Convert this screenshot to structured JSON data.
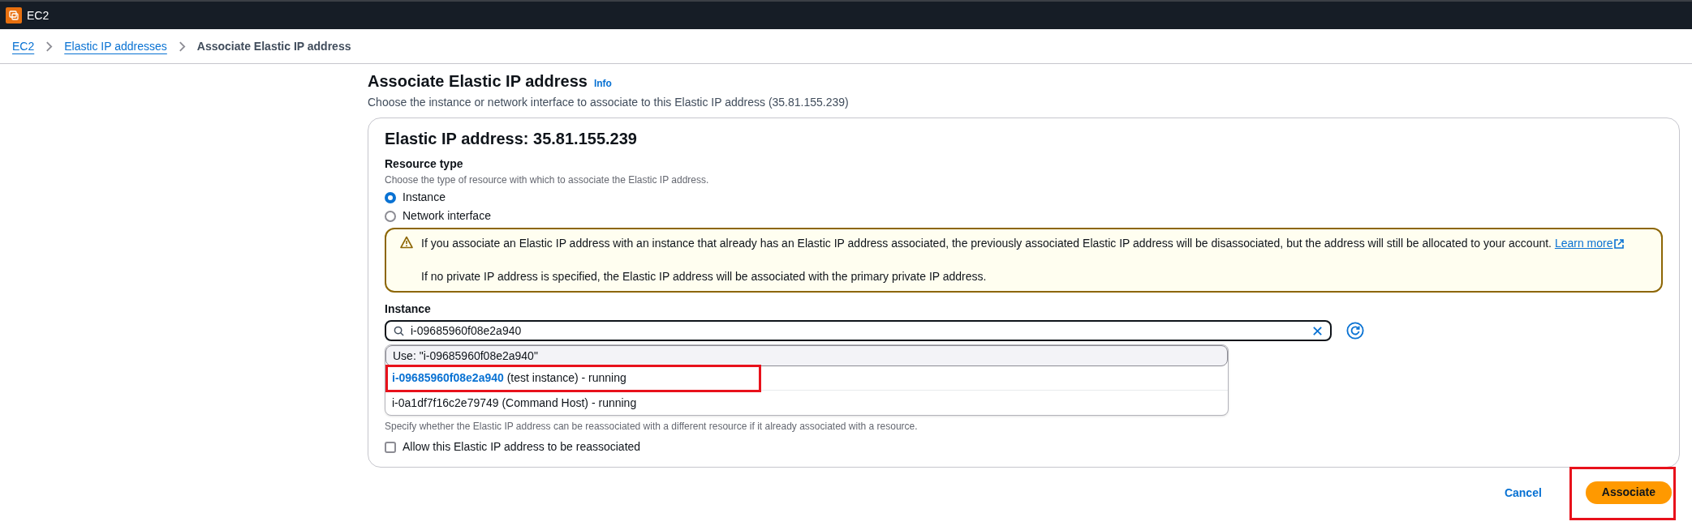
{
  "top_bar": {
    "service": "EC2"
  },
  "breadcrumbs": [
    {
      "label": "EC2",
      "link": true
    },
    {
      "label": "Elastic IP addresses",
      "link": true
    },
    {
      "label": "Associate Elastic IP address",
      "link": false
    }
  ],
  "page": {
    "title": "Associate Elastic IP address",
    "info": "Info",
    "description": "Choose the instance or network interface to associate to this Elastic IP address (35.81.155.239)"
  },
  "card": {
    "title": "Elastic IP address: 35.81.155.239",
    "resource_type": {
      "label": "Resource type",
      "hint": "Choose the type of resource with which to associate the Elastic IP address.",
      "options": [
        {
          "label": "Instance",
          "selected": true
        },
        {
          "label": "Network interface",
          "selected": false
        }
      ]
    },
    "warning": {
      "text": "If you associate an Elastic IP address with an instance that already has an Elastic IP address associated, the previously associated Elastic IP address will be disassociated, but the address will still be allocated to your account.",
      "link": "Learn more",
      "note": "If no private IP address is specified, the Elastic IP address will be associated with the primary private IP address."
    },
    "instance": {
      "label": "Instance",
      "value": "i-09685960f08e2a940",
      "dropdown": [
        {
          "kind": "use",
          "text": "Use: \"i-09685960f08e2a940\"",
          "highlighted": false
        },
        {
          "kind": "option",
          "id": "i-09685960f08e2a940",
          "text": "(test instance) - running",
          "highlighted": true
        },
        {
          "kind": "option",
          "id": "i-0a1df7f16c2e79749",
          "text": "(Command Host) - running",
          "highlighted": false
        }
      ]
    },
    "reassociation": {
      "hint": "Specify whether the Elastic IP address can be reassociated with a different resource if it already associated with a resource.",
      "checkbox": {
        "label": "Allow this Elastic IP address to be reassociated",
        "checked": false
      }
    }
  },
  "actions": [
    {
      "kind": "link",
      "label": "Cancel",
      "highlighted": false
    },
    {
      "kind": "primary",
      "label": "Associate",
      "highlighted": true
    }
  ]
}
